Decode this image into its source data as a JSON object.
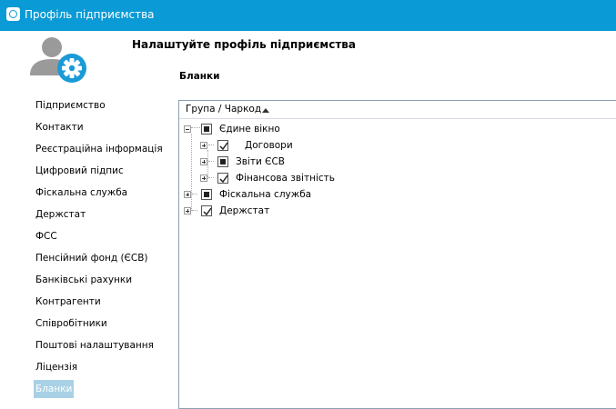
{
  "window": {
    "title": "Профіль підприємства"
  },
  "page": {
    "title": "Налаштуйте профіль підприємства"
  },
  "section": {
    "title": "Бланки"
  },
  "sidebar": {
    "items": [
      {
        "label": "Підприємство"
      },
      {
        "label": "Контакти"
      },
      {
        "label": "Реєстраційна інформація"
      },
      {
        "label": "Цифровий підпис"
      },
      {
        "label": "Фіскальна служба"
      },
      {
        "label": "Держстат"
      },
      {
        "label": "ФСС"
      },
      {
        "label": "Пенсійний фонд (ЄСВ)"
      },
      {
        "label": "Банківські рахунки"
      },
      {
        "label": "Контрагенти"
      },
      {
        "label": "Співробітники"
      },
      {
        "label": "Поштові налаштування"
      },
      {
        "label": "Ліцензія"
      },
      {
        "label": "Бланки",
        "active": true
      }
    ]
  },
  "tree": {
    "column_header": "Група / Чаркод",
    "sort": "ascending",
    "rows": [
      {
        "label": "Єдине вікно",
        "state": "partial",
        "expander": "minus"
      },
      {
        "label": "Договори",
        "state": "checked",
        "expander": "plus"
      },
      {
        "label": "Звіти ЄСВ",
        "state": "partial",
        "expander": "plus"
      },
      {
        "label": "Фінансова звітність",
        "state": "checked",
        "expander": "plus"
      },
      {
        "label": "Фіскальна служба",
        "state": "partial",
        "expander": "plus"
      },
      {
        "label": "Держстат",
        "state": "checked",
        "expander": "plus"
      }
    ]
  },
  "colors": {
    "titlebar": "#0a9ad6",
    "active_nav": "#a9d1e6",
    "avatar_badge": "#1a9bd7"
  }
}
